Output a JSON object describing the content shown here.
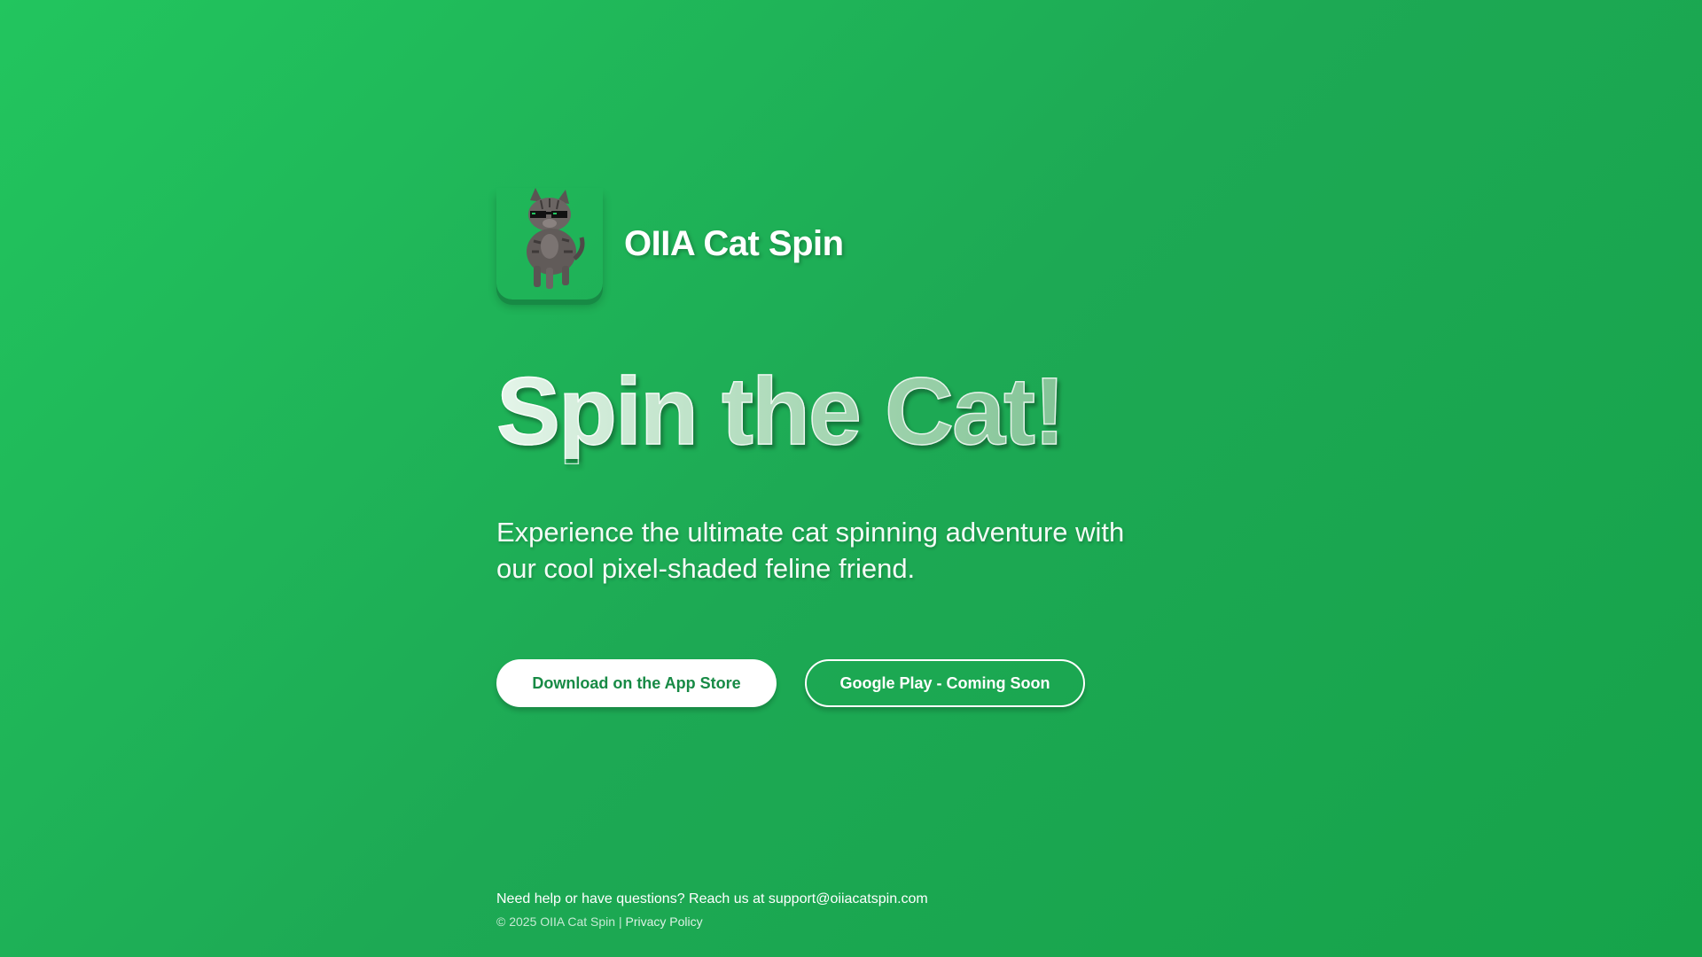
{
  "header": {
    "app_name": "OIIA Cat Spin",
    "icon": "cat-with-sunglasses-icon"
  },
  "hero": {
    "title": "Spin the Cat!",
    "subtitle": "Experience the ultimate cat spinning adventure with our cool pixel-shaded feline friend."
  },
  "buttons": {
    "appstore_label": "Download on the App Store",
    "google_label": "Google Play - Coming Soon"
  },
  "footer": {
    "help_text": "Need help or have questions? Reach us at",
    "email": "support@oiiacatspin.com",
    "copyright": "© 2025 OIIA Cat Spin",
    "separator": "|",
    "privacy_label": "Privacy Policy"
  },
  "colors": {
    "background": "#22c55e",
    "accent": "#178a45",
    "button_text": "#178a45"
  }
}
